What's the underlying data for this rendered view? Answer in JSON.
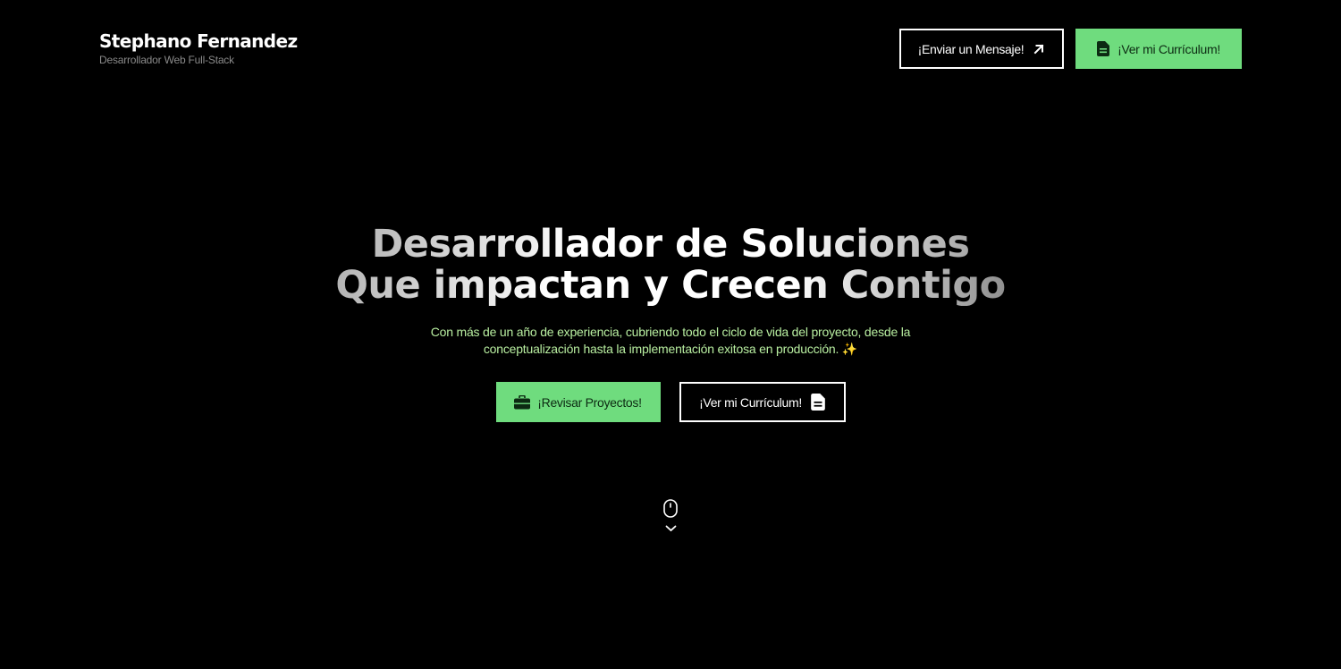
{
  "brand": {
    "name": "Stephano Fernandez",
    "role": "Desarrollador Web Full-Stack"
  },
  "header": {
    "message_button": {
      "label": "¡Enviar un Mensaje!",
      "icon": "arrow-up-right-icon"
    },
    "cv_button": {
      "label": "¡Ver mi Currículum!",
      "icon": "document-icon"
    }
  },
  "hero": {
    "headline_line1": "Desarrollador de Soluciones",
    "headline_line2": "Que impactan y Crecen Contigo",
    "subtitle_line1": "Con más de un año de experiencia, cubriendo todo el ciclo de vida del proyecto, desde la",
    "subtitle_line2": "conceptualización hasta la implementación exitosa en producción. ✨",
    "projects_button": {
      "label": "¡Revisar Proyectos!",
      "icon": "briefcase-icon"
    },
    "cv_button": {
      "label": "¡Ver mi Currículum!",
      "icon": "document-icon"
    }
  },
  "scroll_indicator": {
    "icon": "mouse-icon",
    "arrow": "chevron-down-icon"
  },
  "colors": {
    "background": "#000000",
    "accent_green": "#6fdc7e",
    "subtitle_green": "#b8eea0",
    "text": "#ffffff"
  }
}
